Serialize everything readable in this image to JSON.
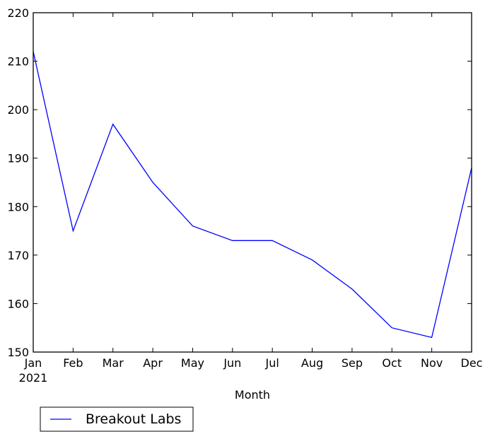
{
  "chart_data": {
    "type": "line",
    "title": "",
    "xlabel": "Month",
    "ylabel": "",
    "categories": [
      "Jan",
      "Feb",
      "Mar",
      "Apr",
      "May",
      "Jun",
      "Jul",
      "Aug",
      "Sep",
      "Oct",
      "Nov",
      "Dec"
    ],
    "x_year_label": "2021",
    "series": [
      {
        "name": "Breakout Labs",
        "color": "#0000ff",
        "values": [
          212,
          175,
          197,
          185,
          176,
          173,
          173,
          169,
          163,
          155,
          153,
          188
        ]
      }
    ],
    "ylim": [
      150,
      220
    ],
    "yticks": [
      150,
      160,
      170,
      180,
      190,
      200,
      210,
      220
    ],
    "grid": false,
    "legend": {
      "position": "bottom-left-outside",
      "entries": [
        "Breakout Labs"
      ]
    }
  }
}
